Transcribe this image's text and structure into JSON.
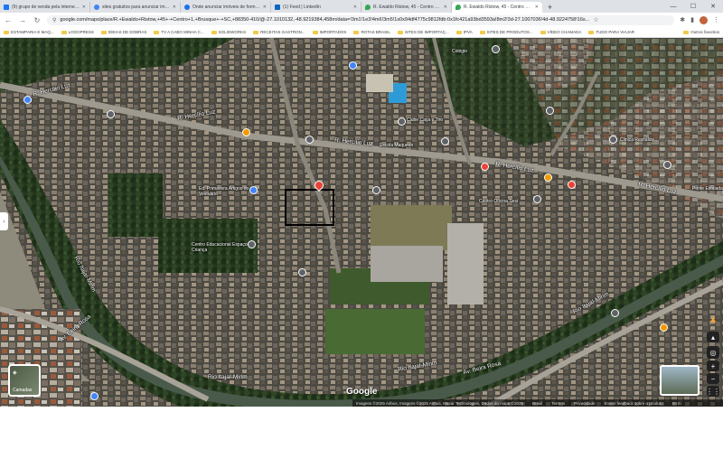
{
  "browser": {
    "tabs": [
      {
        "title": "(9) grupo de venda pela internet Sc",
        "favicon_color": "#1877f2",
        "active": false
      },
      {
        "title": "sites gratuitos para anunciar imovei",
        "favicon_color": "#4285f4",
        "active": false
      },
      {
        "title": "Onde anunciar imóveis de forma gr",
        "favicon_color": "#1a73e8",
        "active": false
      },
      {
        "title": "(1) Feed | LinkedIn",
        "favicon_color": "#0a66c2",
        "active": false
      },
      {
        "title": "R. Ewaldo Ristow, 45 - Centro 1 - B",
        "favicon_color": "#34a853",
        "active": false
      },
      {
        "title": "R. Ewaldo Ristow, 45 - Centro 1 - B",
        "favicon_color": "#34a853",
        "active": true
      }
    ],
    "new_tab": "+",
    "window_controls": {
      "minimize": "—",
      "maximize": "☐",
      "close": "✕"
    },
    "url": "google.com/maps/place/R.+Ewaldo+Ristow,+45+-+Centro+1,+Brusque+-+SC,+88350-410/@-27.1010132,-48.9219384,458m/data=!3m1!1e3!4m6!3m5!1s0x94df4775c9812fdb:0x1fc421a93bd3593a!8m2!3d-27.1007036!4d-48.9224758!16s...",
    "bookmarks": [
      "ESTAMPARIA E MAQ...",
      "LOGOPRESS",
      "IDEIAS DE DOBRAS",
      "TV A CABO MINHA C...",
      "SOLIDWORKS",
      "RECEITAS GASTRON...",
      "IMPORTADOS",
      "ROTAS BRASIL",
      "SITES DE IMPORTAÇ...",
      "IPVA",
      "SITES DE PRODUTOS...",
      "VÍDEO CHAMADA",
      "TUDO PARA VIAJAR"
    ],
    "other_bookmarks": "Outros favoritos"
  },
  "map": {
    "labels": {
      "street_top_left": "R. Hercílio Luz",
      "street_top_left2": "R. Hercílio Luz",
      "street_center": "R. Hercílio Luz",
      "street_right": "R. Hercílio Luz",
      "street_far_right": "R. Hercílio Luz",
      "rio1": "Rio Itajaí-Mirim",
      "rio2": "Rio Itajaí-Mirim",
      "rio3": "Rio Itajaí-Mirim",
      "rio4": "Rio Itajaí-Mirim",
      "av1": "Av. Beira Rosa",
      "av2": "Av. Beira Rosa",
      "clube": "Clube Caça e Tiro",
      "escola": "Escola Maqueun",
      "colegio": "Colégio",
      "centro_educacional": "Centro Educacional Espaço da Criança",
      "ed_primavera": "Ed. Primavera Artigos do Vestuário",
      "clinica": "Clinica Revitalize",
      "ponte": "Ponte Estaiada",
      "centro_oficina": "Centro Oficina Sesi"
    },
    "layers_label": "Camadas",
    "google": "Google",
    "footer": [
      "Imagens ©2025 Airbus, Imagens ©2025 Airbus, Maxar Technologies, Dados do mapa ©2025",
      "Brasil",
      "Termos",
      "Privacidade",
      "Enviar feedback sobre o produto",
      "50 m"
    ]
  }
}
